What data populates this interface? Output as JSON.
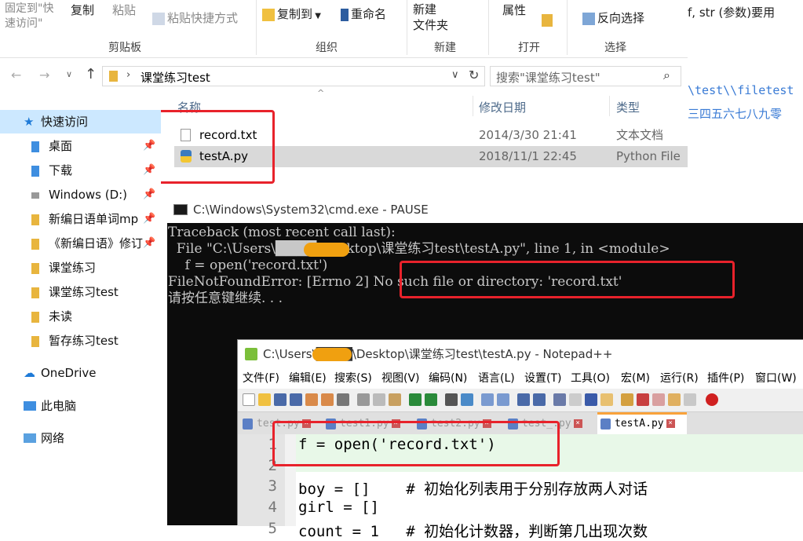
{
  "background_doc": {
    "line1": "f, str (参数)要用",
    "line2": "\\test\\\\filetest",
    "line3": "三四五六七八九零"
  },
  "explorer": {
    "ribbon": {
      "pin_label": "固定到\"快\n速访问\"",
      "copy": "复制",
      "paste": "粘贴",
      "paste_shortcut": "粘贴快捷方式",
      "copy_to": "复制到",
      "rename": "重命名",
      "new_folder": "新建\n文件夹",
      "properties": "属性",
      "invert_select": "反向选择",
      "groups": [
        "剪贴板",
        "组织",
        "新建",
        "打开",
        "选择"
      ]
    },
    "address": {
      "path": "课堂练习test",
      "search_placeholder": "搜索\"课堂练习test\""
    },
    "nav": [
      {
        "label": "快速访问",
        "pinned": false
      },
      {
        "label": "桌面",
        "pinned": true
      },
      {
        "label": "下载",
        "pinned": true
      },
      {
        "label": "Windows (D:)",
        "pinned": true
      },
      {
        "label": "新编日语单词mp",
        "pinned": true
      },
      {
        "label": "《新编日语》修订",
        "pinned": true
      },
      {
        "label": "课堂练习",
        "pinned": false
      },
      {
        "label": "课堂练习test",
        "pinned": false
      },
      {
        "label": "未读",
        "pinned": false
      },
      {
        "label": "暂存练习test",
        "pinned": false
      },
      {
        "label": "OneDrive",
        "pinned": false
      },
      {
        "label": "此电脑",
        "pinned": false
      },
      {
        "label": "网络",
        "pinned": false
      }
    ],
    "columns": {
      "name": "名称",
      "modified": "修改日期",
      "type": "类型"
    },
    "files": [
      {
        "name": "record.txt",
        "modified": "2014/3/30 21:41",
        "type": "文本文档"
      },
      {
        "name": "testA.py",
        "modified": "2018/11/1 22:45",
        "type": "Python File"
      }
    ]
  },
  "cmd": {
    "title": "C:\\Windows\\System32\\cmd.exe - PAUSE",
    "lines": [
      "Traceback (most recent call last):",
      "  File \"C:\\Users\\████\\Desktop\\课堂练习test\\testA.py\", line 1, in <module>",
      "    f = open('record.txt')",
      "FileNotFoundError: [Errno 2] No such file or directory: 'record.txt'",
      "请按任意键继续. . ."
    ]
  },
  "notepad": {
    "title": "C:\\Users\\████\\Desktop\\课堂练习test\\testA.py - Notepad++",
    "menu": [
      "文件(F)",
      "编辑(E)",
      "搜索(S)",
      "视图(V)",
      "编码(N)",
      "语言(L)",
      "设置(T)",
      "工具(O)",
      "宏(M)",
      "运行(R)",
      "插件(P)",
      "窗口(W)"
    ],
    "tabs": [
      "test.py",
      "test1.py",
      "test2.py",
      "test_.py",
      "testA.py"
    ],
    "lines": [
      {
        "n": "1",
        "code": "f = open('record.txt')"
      },
      {
        "n": "2",
        "code": ""
      },
      {
        "n": "3",
        "code": "boy = []    # 初始化列表用于分别存放两人对话"
      },
      {
        "n": "4",
        "code": "girl = []"
      },
      {
        "n": "5",
        "code": "count = 1   # 初始化计数器，判断第几出现次数"
      }
    ]
  }
}
